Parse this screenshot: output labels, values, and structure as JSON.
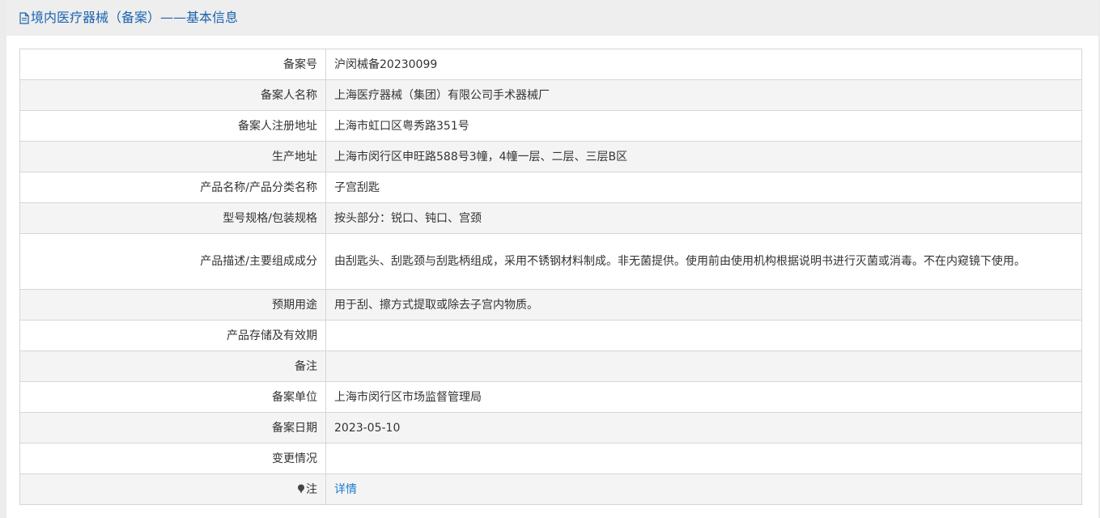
{
  "header": {
    "icon": "document-icon",
    "title": "境内医疗器械（备案）——基本信息"
  },
  "colors": {
    "title": "#1a64b0",
    "link": "#1a7bd0",
    "border": "#d6d6d6",
    "stripe": "#f4f4f4"
  },
  "rows": [
    {
      "label": "备案号",
      "value": "沪闵械备20230099"
    },
    {
      "label": "备案人名称",
      "value": "上海医疗器械（集团）有限公司手术器械厂"
    },
    {
      "label": "备案人注册地址",
      "value": "上海市虹口区粤秀路351号"
    },
    {
      "label": "生产地址",
      "value": "上海市闵行区申旺路588号3幢，4幢一层、二层、三层B区"
    },
    {
      "label": "产品名称/产品分类名称",
      "value": "子宫刮匙"
    },
    {
      "label": "型号规格/包装规格",
      "value": "按头部分：锐口、钝口、宫颈"
    },
    {
      "label": "产品描述/主要组成成分",
      "value": "由刮匙头、刮匙颈与刮匙柄组成，采用不锈钢材料制成。非无菌提供。使用前由使用机构根据说明书进行灭菌或消毒。不在内窥镜下使用。"
    },
    {
      "label": "预期用途",
      "value": "用于刮、擦方式提取或除去子宫内物质。"
    },
    {
      "label": "产品存储及有效期",
      "value": ""
    },
    {
      "label": "备注",
      "value": ""
    },
    {
      "label": "备案单位",
      "value": "上海市闵行区市场监督管理局"
    },
    {
      "label": "备案日期",
      "value": "2023-05-10"
    },
    {
      "label": "变更情况",
      "value": ""
    },
    {
      "label": "注",
      "icon": "pin-icon",
      "link": "详情"
    }
  ]
}
